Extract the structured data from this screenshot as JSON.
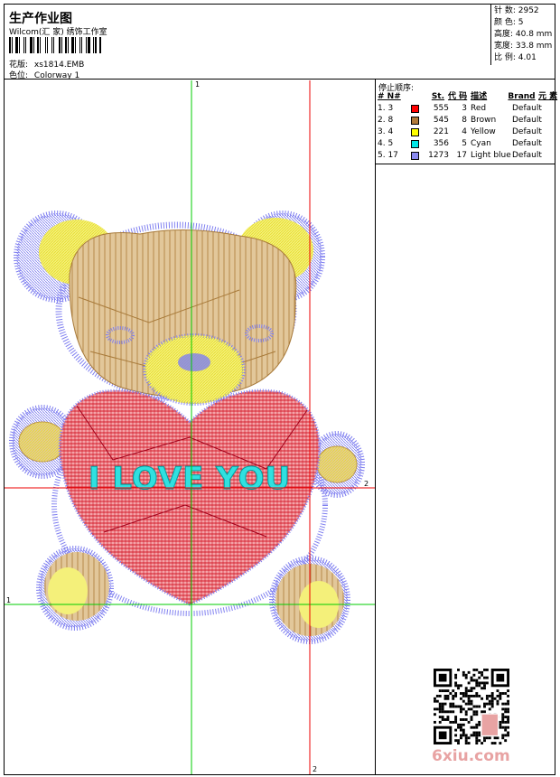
{
  "header": {
    "title": "生产作业图",
    "company": "Wilcom(汇 家) 绣饰工作室",
    "design_label": "花版:",
    "design_value": "xs1814.EMB",
    "colorway_label": "色位:",
    "colorway_value": "Colorway 1"
  },
  "stats": {
    "stitches": "针 数: 2952",
    "colors": "颜 色: 5",
    "height": "高度: 40.8 mm",
    "width": "宽度: 33.8 mm",
    "ratio": "比 例: 4.01"
  },
  "sequence": {
    "title": "停止顺序:",
    "headers": {
      "num": "# N#",
      "st": "St.",
      "code": "代 码",
      "desc": "描述",
      "brand": "Brand",
      "elem": "元 素"
    },
    "rows": [
      {
        "num": "1. 3",
        "color": "#ff0000",
        "st": "555",
        "code": "3",
        "desc": "Red",
        "brand": "Default"
      },
      {
        "num": "2. 8",
        "color": "#b07a3a",
        "st": "545",
        "code": "8",
        "desc": "Brown",
        "brand": "Default"
      },
      {
        "num": "3. 4",
        "color": "#ffff00",
        "st": "221",
        "code": "4",
        "desc": "Yellow",
        "brand": "Default"
      },
      {
        "num": "4. 5",
        "color": "#00e5e5",
        "st": "356",
        "code": "5",
        "desc": "Cyan",
        "brand": "Default"
      },
      {
        "num": "5. 17",
        "color": "#8a8af0",
        "st": "1273",
        "code": "17",
        "desc": "Light blue",
        "brand": "Default"
      }
    ]
  },
  "axes": {
    "green_top": "1",
    "green_left": "1",
    "red_right": "2",
    "red_bottom": "2"
  },
  "embroidery_text": "I LOVE YOU",
  "watermark": "6xiu.com",
  "colors": {
    "axis_green": "#00cc00",
    "axis_red": "#ee0000",
    "fur_blue": "#8080f0",
    "brown": "#c49a5a",
    "yellow": "#f4f07a",
    "red": "#e0202a",
    "cyan": "#30e0e0"
  }
}
